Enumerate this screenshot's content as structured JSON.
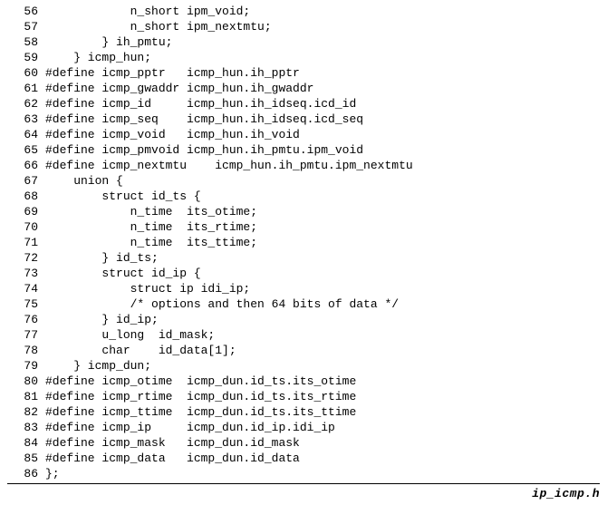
{
  "filename": "ip_icmp.h",
  "lines": [
    {
      "num": 56,
      "text": "            n_short ipm_void;"
    },
    {
      "num": 57,
      "text": "            n_short ipm_nextmtu;"
    },
    {
      "num": 58,
      "text": "        } ih_pmtu;"
    },
    {
      "num": 59,
      "text": "    } icmp_hun;"
    },
    {
      "num": 60,
      "text": "#define icmp_pptr   icmp_hun.ih_pptr"
    },
    {
      "num": 61,
      "text": "#define icmp_gwaddr icmp_hun.ih_gwaddr"
    },
    {
      "num": 62,
      "text": "#define icmp_id     icmp_hun.ih_idseq.icd_id"
    },
    {
      "num": 63,
      "text": "#define icmp_seq    icmp_hun.ih_idseq.icd_seq"
    },
    {
      "num": 64,
      "text": "#define icmp_void   icmp_hun.ih_void"
    },
    {
      "num": 65,
      "text": "#define icmp_pmvoid icmp_hun.ih_pmtu.ipm_void"
    },
    {
      "num": 66,
      "text": "#define icmp_nextmtu    icmp_hun.ih_pmtu.ipm_nextmtu"
    },
    {
      "num": 67,
      "text": "    union {"
    },
    {
      "num": 68,
      "text": "        struct id_ts {"
    },
    {
      "num": 69,
      "text": "            n_time  its_otime;"
    },
    {
      "num": 70,
      "text": "            n_time  its_rtime;"
    },
    {
      "num": 71,
      "text": "            n_time  its_ttime;"
    },
    {
      "num": 72,
      "text": "        } id_ts;"
    },
    {
      "num": 73,
      "text": "        struct id_ip {"
    },
    {
      "num": 74,
      "text": "            struct ip idi_ip;"
    },
    {
      "num": 75,
      "text": "            /* options and then 64 bits of data */"
    },
    {
      "num": 76,
      "text": "        } id_ip;"
    },
    {
      "num": 77,
      "text": "        u_long  id_mask;"
    },
    {
      "num": 78,
      "text": "        char    id_data[1];"
    },
    {
      "num": 79,
      "text": "    } icmp_dun;"
    },
    {
      "num": 80,
      "text": "#define icmp_otime  icmp_dun.id_ts.its_otime"
    },
    {
      "num": 81,
      "text": "#define icmp_rtime  icmp_dun.id_ts.its_rtime"
    },
    {
      "num": 82,
      "text": "#define icmp_ttime  icmp_dun.id_ts.its_ttime"
    },
    {
      "num": 83,
      "text": "#define icmp_ip     icmp_dun.id_ip.idi_ip"
    },
    {
      "num": 84,
      "text": "#define icmp_mask   icmp_dun.id_mask"
    },
    {
      "num": 85,
      "text": "#define icmp_data   icmp_dun.id_data"
    },
    {
      "num": 86,
      "text": "};"
    }
  ]
}
